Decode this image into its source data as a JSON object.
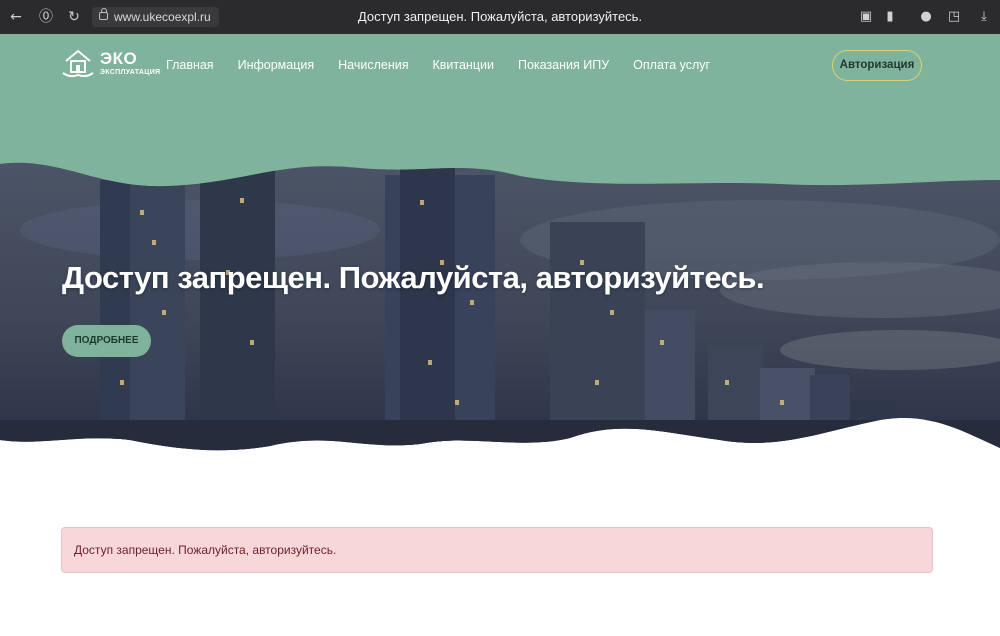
{
  "browser": {
    "url": "www.ukecoexpl.ru",
    "tab_title": "Доступ запрещен. Пожалуйста, авторизуйтесь."
  },
  "site": {
    "logo": {
      "brand": "ЭКО",
      "subtitle": "ЭКСПЛУАТАЦИЯ"
    },
    "menu": [
      {
        "label": "Главная"
      },
      {
        "label": "Информация"
      },
      {
        "label": "Начисления"
      },
      {
        "label": "Квитанции"
      },
      {
        "label": "Показания ИПУ"
      },
      {
        "label": "Оплата услуг"
      }
    ],
    "auth_label": "Авторизация",
    "accent_color": "#7fb39b"
  },
  "hero": {
    "title": "Доступ запрещен. Пожалуйста, авторизуйтесь.",
    "button_label": "ПОДРОБНЕЕ"
  },
  "alert": {
    "message": "Доступ запрещен. Пожалуйста, авторизуйтесь."
  }
}
